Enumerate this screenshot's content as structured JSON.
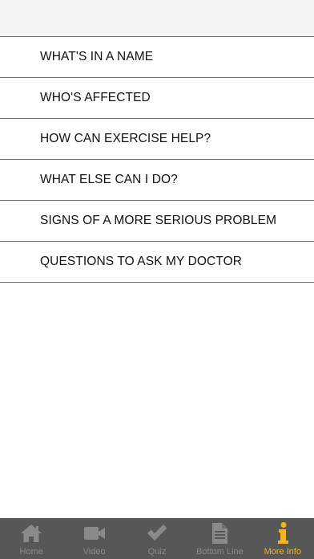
{
  "menu": {
    "items": [
      {
        "label": "WHAT'S IN A NAME"
      },
      {
        "label": "WHO'S AFFECTED"
      },
      {
        "label": "HOW CAN EXERCISE HELP?"
      },
      {
        "label": "WHAT ELSE CAN I DO?"
      },
      {
        "label": "SIGNS OF A MORE SERIOUS PROBLEM"
      },
      {
        "label": "QUESTIONS TO ASK MY DOCTOR"
      }
    ]
  },
  "tab_bar": {
    "active": "More Info",
    "colors": {
      "background": "#575757",
      "inactive": "#8a8a8a",
      "active": "#f3b51c"
    },
    "tabs": [
      {
        "label": "Home",
        "icon": "home-icon"
      },
      {
        "label": "Video",
        "icon": "video-camera-icon"
      },
      {
        "label": "Quiz",
        "icon": "checkmark-icon"
      },
      {
        "label": "Bottom Line",
        "icon": "document-icon"
      },
      {
        "label": "More Info",
        "icon": "info-icon"
      }
    ]
  }
}
